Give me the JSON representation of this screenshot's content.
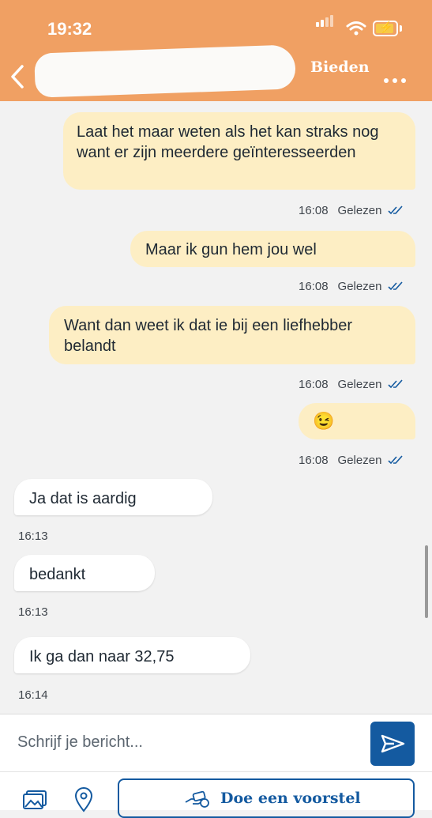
{
  "status_bar": {
    "time": "19:32"
  },
  "header": {
    "bieden_label": "Bieden"
  },
  "messages": [
    {
      "direction": "out",
      "text": "Laat het maar weten als het kan straks nog want er zijn meerdere geïnteresseerden",
      "time": "16:08",
      "status": "Gelezen"
    },
    {
      "direction": "out",
      "text": "Maar ik gun hem jou wel",
      "time": "16:08",
      "status": "Gelezen"
    },
    {
      "direction": "out",
      "text": "Want dan weet ik dat ie bij een liefhebber belandt",
      "time": "16:08",
      "status": "Gelezen"
    },
    {
      "direction": "out",
      "text": "😉",
      "time": "16:08",
      "status": "Gelezen"
    },
    {
      "direction": "in",
      "text": "Ja dat is aardig",
      "time": "16:13"
    },
    {
      "direction": "in",
      "text": "bedankt",
      "time": "16:13"
    },
    {
      "direction": "in",
      "text": "Ik ga dan naar 32,75",
      "time": "16:14"
    }
  ],
  "composer": {
    "placeholder": "Schrijf je bericht..."
  },
  "actions": {
    "offer_label": "Doe een voorstel"
  },
  "colors": {
    "header": "#f0a063",
    "outgoing_bubble": "#fdeec4",
    "accent": "#145aa0"
  }
}
